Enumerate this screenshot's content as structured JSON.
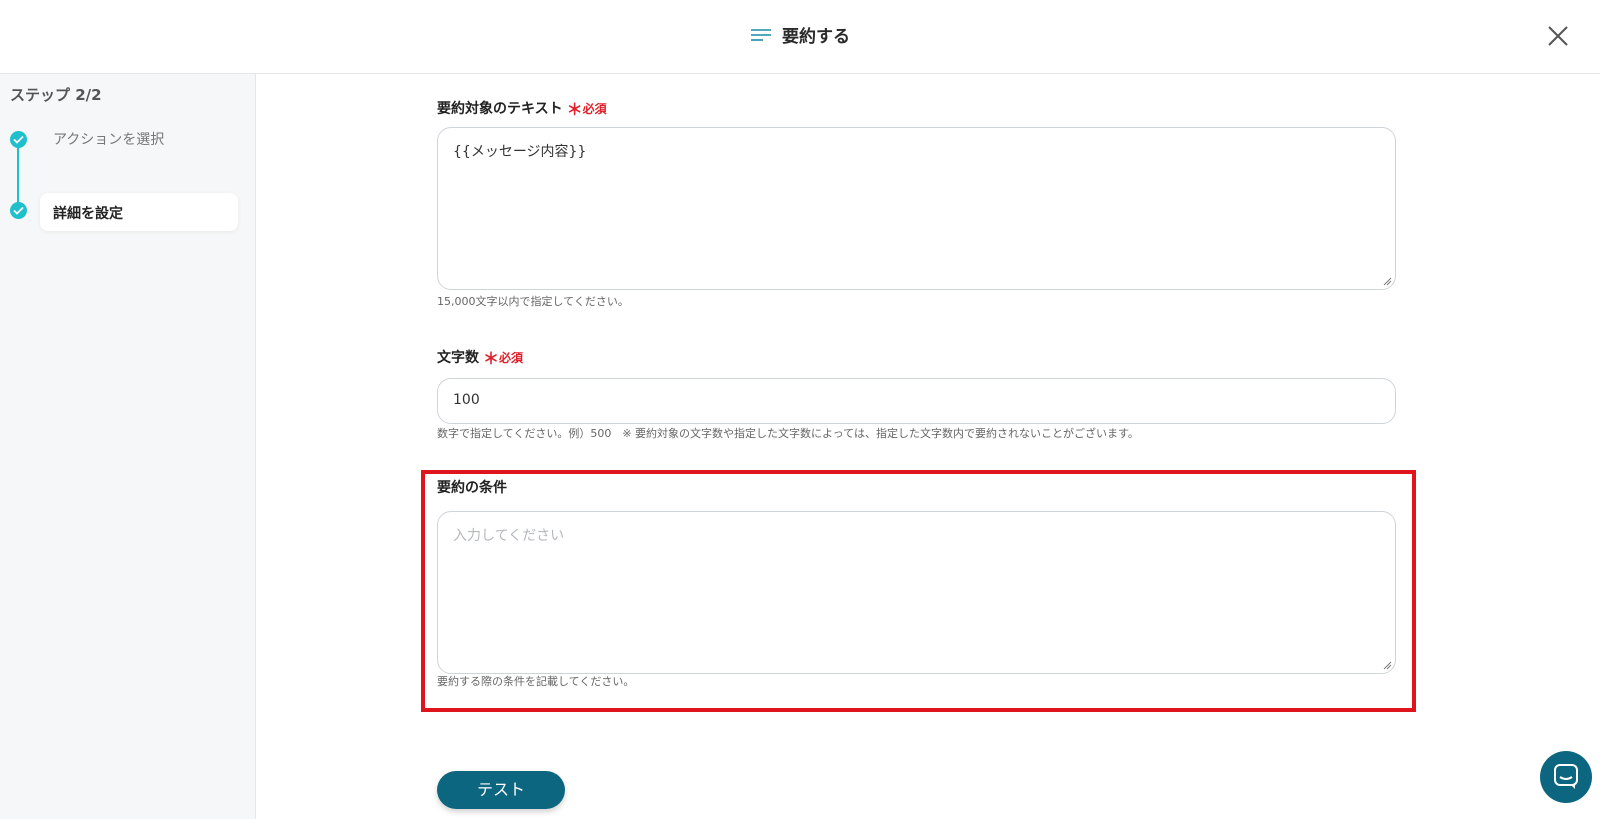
{
  "header": {
    "title": "要約する",
    "title_icon": "text-lines-icon",
    "close_icon": "close-icon"
  },
  "sidebar": {
    "step_label": "ステップ 2/2",
    "steps": [
      {
        "label": "アクションを選択",
        "state": "done"
      },
      {
        "label": "詳細を設定",
        "state": "active"
      }
    ]
  },
  "form": {
    "target_text": {
      "label": "要約対象のテキスト",
      "required_mark": "＊",
      "required_text": "必須",
      "value": "{{メッセージ内容}}",
      "help": "15,000文字以内で指定してください。"
    },
    "char_count": {
      "label": "文字数",
      "required_mark": "＊",
      "required_text": "必須",
      "value": "100",
      "help": "数字で指定してください。例）500　※ 要約対象の文字数や指定した文字数によっては、指定した文字数内で要約されないことがございます。"
    },
    "conditions": {
      "label": "要約の条件",
      "placeholder": "入力してください",
      "value": "",
      "help": "要約する際の条件を記載してください。"
    }
  },
  "actions": {
    "test_label": "テスト"
  },
  "colors": {
    "accent": "#1fbfcc",
    "button": "#0d6680",
    "required": "#e0202a",
    "highlight": "#e0141c"
  }
}
